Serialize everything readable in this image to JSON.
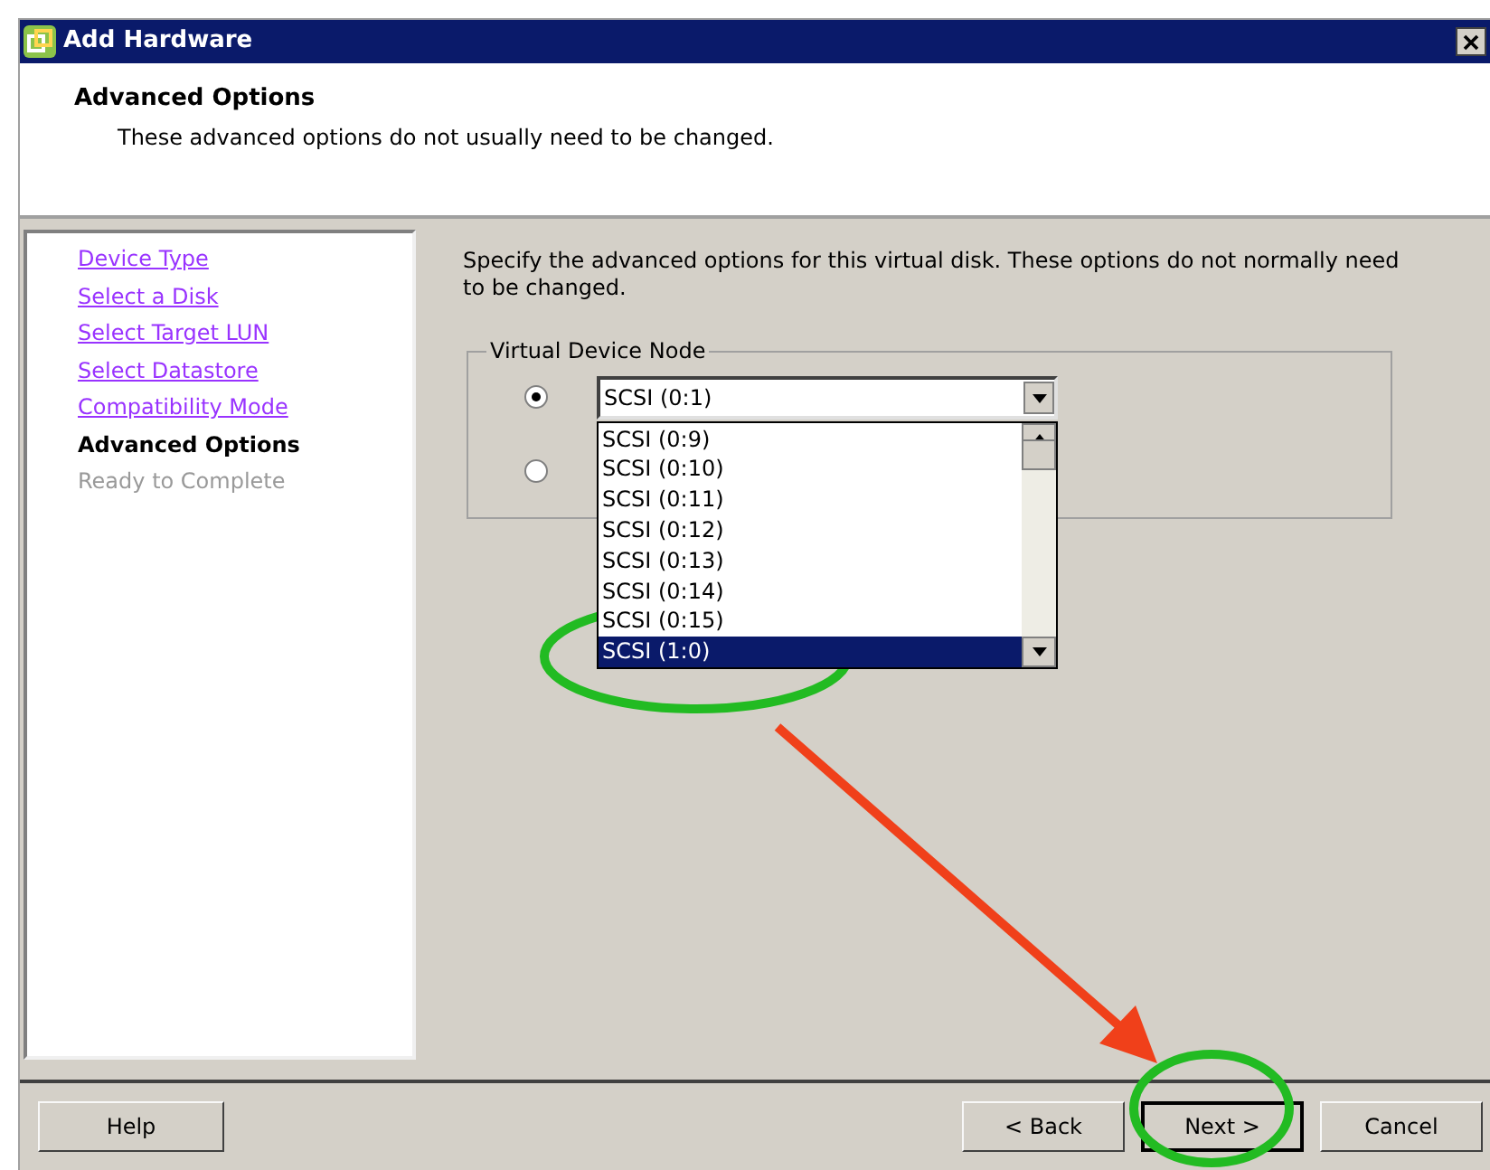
{
  "window": {
    "title": "Add Hardware"
  },
  "header": {
    "title": "Advanced Options",
    "subtitle": "These advanced options do not usually need to be changed."
  },
  "steps": [
    {
      "label": "Device Type",
      "kind": "link"
    },
    {
      "label": "Select a Disk",
      "kind": "link"
    },
    {
      "label": "Select Target LUN",
      "kind": "link"
    },
    {
      "label": "Select Datastore",
      "kind": "link"
    },
    {
      "label": "Compatibility Mode",
      "kind": "link"
    },
    {
      "label": "Advanced Options",
      "kind": "current"
    },
    {
      "label": "Ready to Complete",
      "kind": "pending"
    }
  ],
  "description": "Specify the advanced options for this virtual disk. These options do not normally need to be changed.",
  "group": {
    "title": "Virtual Device Node",
    "radios": [
      {
        "selected": true
      },
      {
        "selected": false
      }
    ],
    "dropdown": {
      "value": "SCSI (0:1)"
    },
    "dropdown_list": [
      {
        "label": "SCSI (0:9)",
        "selected": false
      },
      {
        "label": "SCSI (0:10)",
        "selected": false
      },
      {
        "label": "SCSI (0:11)",
        "selected": false
      },
      {
        "label": "SCSI (0:12)",
        "selected": false
      },
      {
        "label": "SCSI (0:13)",
        "selected": false
      },
      {
        "label": "SCSI (0:14)",
        "selected": false
      },
      {
        "label": "SCSI (0:15)",
        "selected": false
      },
      {
        "label": "SCSI (1:0)",
        "selected": true
      }
    ]
  },
  "buttons": [
    {
      "label": "Help",
      "default": false
    },
    {
      "label": "< Back",
      "default": false
    },
    {
      "label": "Next >",
      "default": true
    },
    {
      "label": "Cancel",
      "default": false
    }
  ]
}
